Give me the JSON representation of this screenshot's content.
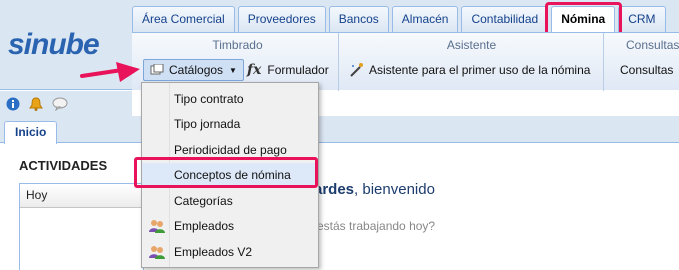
{
  "logo": {
    "part1": "si",
    "part2": "nube"
  },
  "tabs": [
    {
      "label": "Área Comercial",
      "active": false
    },
    {
      "label": "Proveedores",
      "active": false
    },
    {
      "label": "Bancos",
      "active": false
    },
    {
      "label": "Almacén",
      "active": false
    },
    {
      "label": "Contabilidad",
      "active": false
    },
    {
      "label": "Nómina",
      "active": true
    },
    {
      "label": "CRM",
      "active": false
    }
  ],
  "ribbon": {
    "groups": [
      {
        "title": "Timbrado"
      },
      {
        "title": "Asistente"
      },
      {
        "title": "Consultas"
      }
    ],
    "catalogos_label": "Catálogos",
    "formulador_label": "Formulador",
    "asistente_label": "Asistente para el primer uso de la nómina",
    "consultas_label": "Consultas"
  },
  "icons": [
    "info-icon",
    "bell-icon",
    "chat-icon"
  ],
  "inicio_tab": "Inicio",
  "activities": {
    "title": "ACTIVIDADES",
    "hoy": "Hoy"
  },
  "greeting": {
    "strong": "tardes",
    "rest": ", bienvenido",
    "question": "estás trabajando hoy?"
  },
  "dropdown": {
    "items": [
      {
        "label": "Tipo contrato",
        "icon": "none"
      },
      {
        "label": "Tipo jornada",
        "icon": "none"
      },
      {
        "label": "Periodicidad de pago",
        "icon": "none"
      },
      {
        "label": "Conceptos de nómina",
        "icon": "none",
        "highlight": true
      },
      {
        "label": "Categorías",
        "icon": "none"
      },
      {
        "label": "Empleados",
        "icon": "users-icon"
      },
      {
        "label": "Empleados V2",
        "icon": "users-icon"
      }
    ]
  },
  "colors": {
    "highlight": "#e8135a",
    "brand": "#2a64b0",
    "ribbon": "#dbe6f3"
  }
}
